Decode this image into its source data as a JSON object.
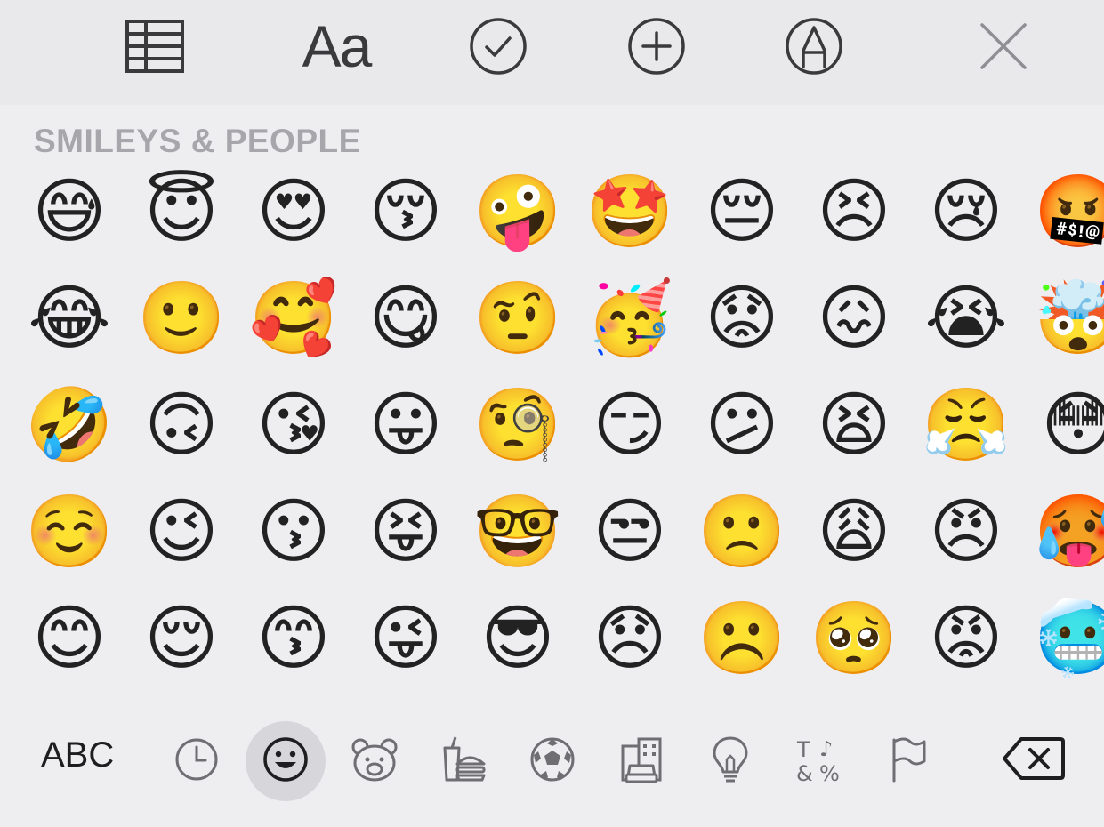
{
  "toolbar": {
    "table_icon": "table-icon",
    "text_format_label": "Aa",
    "checklist_icon": "checkmark-circle-icon",
    "add_icon": "plus-circle-icon",
    "markup_icon": "pen-circle-icon",
    "close_icon": "close-icon"
  },
  "section": {
    "title": "SMILEYS & PEOPLE"
  },
  "emoji_rows": [
    [
      "😅",
      "😇",
      "😍",
      "😚",
      "🤪",
      "🤩",
      "😔",
      "😣",
      "😢",
      "🤬"
    ],
    [
      "😂",
      "🙂",
      "🥰",
      "😋",
      "🤨",
      "🥳",
      "😟",
      "😖",
      "😭",
      "🤯"
    ],
    [
      "🤣",
      "🙃",
      "😘",
      "😛",
      "🧐",
      "😏",
      "😕",
      "😫",
      "😤",
      "😳"
    ],
    [
      "☺️",
      "😉",
      "😗",
      "😝",
      "🤓",
      "😒",
      "🙁",
      "😩",
      "😠",
      "🥵"
    ],
    [
      "😊",
      "😌",
      "😙",
      "😜",
      "😎",
      "😞",
      "☹️",
      "🥺",
      "😡",
      "🥶"
    ]
  ],
  "bottom_bar": {
    "abc_label": "ABC",
    "categories": [
      {
        "icon": "clock-icon",
        "name": "frequently-used"
      },
      {
        "icon": "smiley-icon",
        "name": "smileys-people",
        "active": true
      },
      {
        "icon": "bear-icon",
        "name": "animals-nature"
      },
      {
        "icon": "food-icon",
        "name": "food-drink"
      },
      {
        "icon": "soccer-ball-icon",
        "name": "activity"
      },
      {
        "icon": "building-car-icon",
        "name": "travel-places"
      },
      {
        "icon": "lightbulb-icon",
        "name": "objects"
      },
      {
        "icon": "symbols-icon",
        "name": "symbols"
      },
      {
        "icon": "flag-icon",
        "name": "flags"
      }
    ],
    "delete_icon": "delete-backspace-icon"
  },
  "colors": {
    "background": "#eeeef1",
    "toolbar_background": "#e9e9ec",
    "section_title": "#a6a6ab",
    "icon_stroke": "#3a3a3d",
    "active_category_bg": "#d6d6db"
  }
}
